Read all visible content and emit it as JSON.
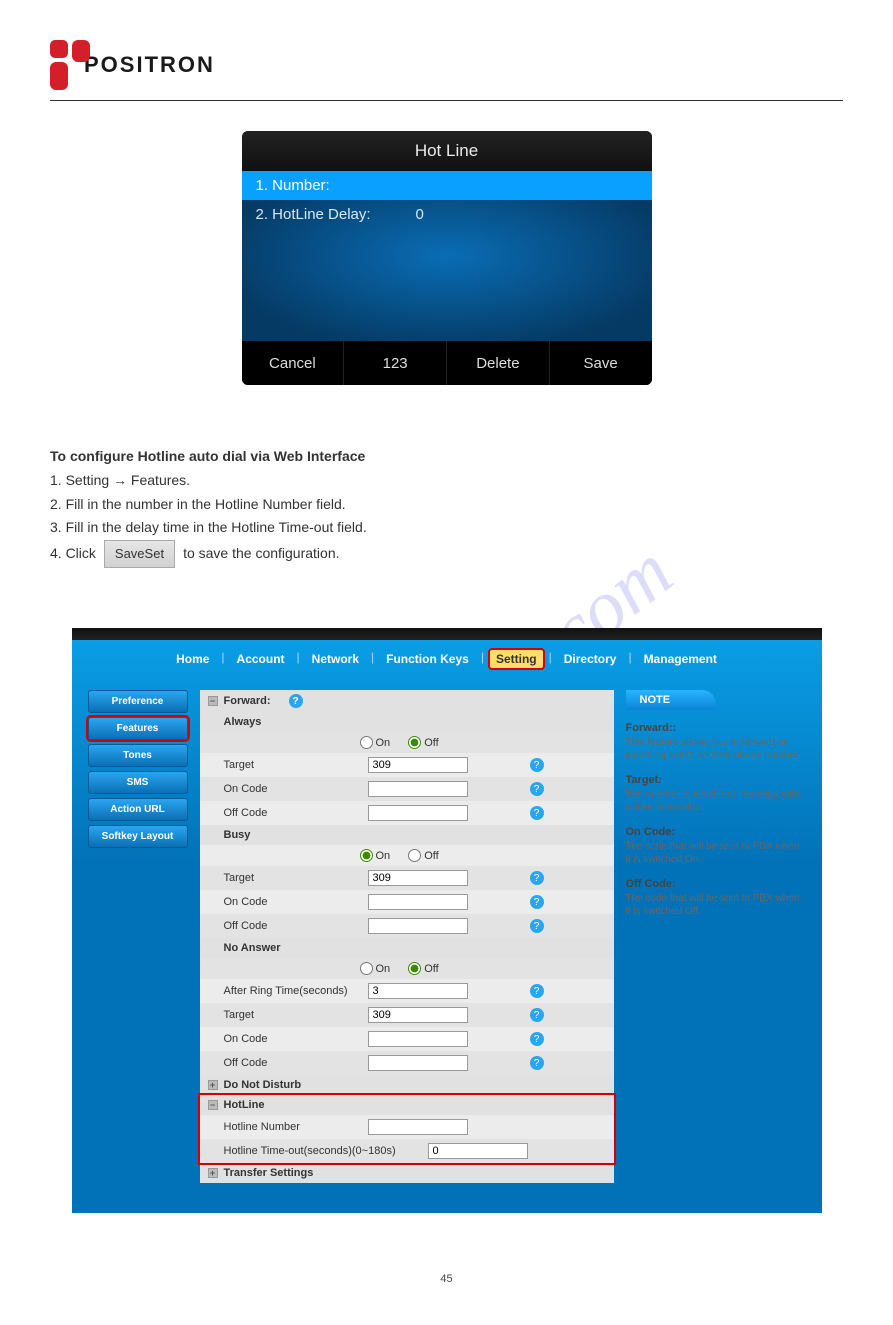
{
  "brand": "POSITRON",
  "lcd": {
    "title": "Hot Line",
    "row1_label": "1. Number:",
    "row1_value": "",
    "row2_label": "2. HotLine Delay:",
    "row2_value": "0",
    "softkeys": {
      "k1": "Cancel",
      "k2": "123",
      "k3": "Delete",
      "k4": "Save"
    }
  },
  "instructions": {
    "line1_prefix": "To configure Hotline auto dial via Web Interface",
    "step1": "1. Setting → Features.",
    "step2": "2. Fill in the number in the Hotline Number field.",
    "step3": "3. Fill in the delay time in the Hotline Time-out field.",
    "step4_prefix": "4. Click",
    "saveset_label": "SaveSet",
    "step4_suffix": "to save the configuration."
  },
  "webui": {
    "nav": {
      "home": "Home",
      "account": "Account",
      "network": "Network",
      "fkeys": "Function Keys",
      "setting": "Setting",
      "directory": "Directory",
      "management": "Management"
    },
    "sidebar": {
      "preference": "Preference",
      "features": "Features",
      "tones": "Tones",
      "sms": "SMS",
      "actionurl": "Action URL",
      "softkey": "Softkey Layout"
    },
    "panel": {
      "forward": "Forward:",
      "always": "Always",
      "busy": "Busy",
      "noanswer": "No Answer",
      "target": "Target",
      "oncode": "On Code",
      "offcode": "Off Code",
      "afterring": "After Ring Time(seconds)",
      "on": "On",
      "off": "Off",
      "target_val_always": "309",
      "target_val_busy": "309",
      "target_val_na": "309",
      "afterring_val": "3",
      "dnd": "Do Not Disturb",
      "hotline": "HotLine",
      "hotline_number": "Hotline Number",
      "hotline_timeout": "Hotline Time-out(seconds)(0~180s)",
      "hotline_number_val": "",
      "hotline_timeout_val": "0",
      "transfer": "Transfer Settings"
    },
    "notes": {
      "tab": "NOTE",
      "forward_h": "Forward::",
      "forward_p": "This feature allows you to forward an incoming call to another phone number.",
      "target_h": "Target:",
      "target_p": "The number to which the incoming calls will be forwarded.",
      "oncode_h": "On Code:",
      "oncode_p": "The code that will be sent to PBX when it is switched On.",
      "offcode_h": "Off Code:",
      "offcode_p": "The code that will be sent to PBX when it is switched Off."
    }
  },
  "watermark": "manualshive.com",
  "page_number": "45"
}
